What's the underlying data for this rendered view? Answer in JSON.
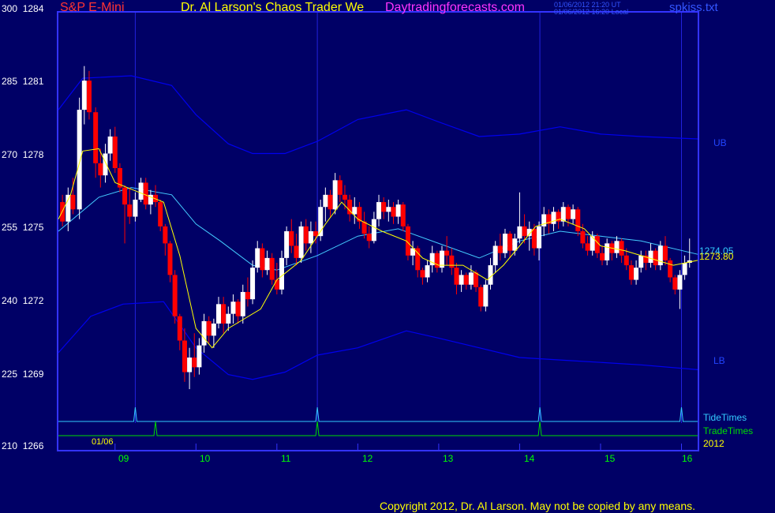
{
  "header": {
    "instrument": "S&P E-Mini",
    "title": "Dr. Al Larson's Chaos Trader We",
    "site": "Daytradingforecasts.com",
    "time_ut": "01/06/2012 21:20 UT",
    "time_local": "01/06/2012 16:20 Local",
    "file": "spkiss.txt"
  },
  "footer": {
    "copyright": "Copyright 2012, Dr. Al Larson. May not be copied by any means."
  },
  "colors": {
    "background": "#000066",
    "frame": "#3333ff",
    "up_candle": "#ffffff",
    "down_candle": "#ff0000",
    "band": "#0000ee",
    "mid_band": "#44ccff",
    "fast_ma": "#ffff00",
    "tide": "#33ccff",
    "trade": "#00dd00",
    "title": "#ffff00",
    "instrument": "#ff3333",
    "site": "#ff33ff"
  },
  "chart_data": {
    "type": "candlestick",
    "y_axis": {
      "ticks": [
        {
          "pos": 300,
          "price": 1284
        },
        {
          "pos": 285,
          "price": 1281
        },
        {
          "pos": 270,
          "price": 1278
        },
        {
          "pos": 255,
          "price": 1275
        },
        {
          "pos": 240,
          "price": 1272
        },
        {
          "pos": 225,
          "price": 1269
        },
        {
          "pos": 210,
          "price": 1266
        }
      ],
      "price_range": [
        1266,
        1284
      ]
    },
    "x_axis": {
      "ticks": [
        "09",
        "10",
        "11",
        "12",
        "13",
        "14",
        "15",
        "16"
      ],
      "start_label": "01/06",
      "year": "2012",
      "hour_range": [
        8.3,
        16.2
      ]
    },
    "band_labels": {
      "upper": "UB",
      "lower": "LB"
    },
    "last_values": {
      "mid_band": "1274.05",
      "close": "1273.80"
    },
    "lines_legend": {
      "tide": "TideTimes",
      "trade": "TradeTimes"
    },
    "tide_times": [
      9.25,
      11.5,
      14.25,
      16.0
    ],
    "trade_times": [
      9.5,
      11.5,
      14.25
    ],
    "band_mid": [
      [
        8.3,
        1275.0
      ],
      [
        8.8,
        1276.4
      ],
      [
        9.2,
        1276.8
      ],
      [
        9.7,
        1276.5
      ],
      [
        10.0,
        1275.3
      ],
      [
        10.3,
        1274.6
      ],
      [
        10.7,
        1273.6
      ],
      [
        11.0,
        1273.4
      ],
      [
        11.5,
        1274.0
      ],
      [
        12.0,
        1274.8
      ],
      [
        12.5,
        1275.1
      ],
      [
        13.0,
        1274.5
      ],
      [
        13.5,
        1273.9
      ],
      [
        14.0,
        1274.6
      ],
      [
        14.5,
        1275.0
      ],
      [
        15.0,
        1274.8
      ],
      [
        15.5,
        1274.6
      ],
      [
        16.2,
        1274.05
      ]
    ],
    "band_upper": [
      [
        8.3,
        1280.0
      ],
      [
        8.6,
        1281.3
      ],
      [
        9.2,
        1281.4
      ],
      [
        9.7,
        1281.0
      ],
      [
        10.0,
        1279.8
      ],
      [
        10.4,
        1278.6
      ],
      [
        10.7,
        1278.2
      ],
      [
        11.1,
        1278.2
      ],
      [
        11.5,
        1278.7
      ],
      [
        12.0,
        1279.6
      ],
      [
        12.6,
        1280.0
      ],
      [
        13.0,
        1279.5
      ],
      [
        13.5,
        1278.9
      ],
      [
        14.0,
        1279.0
      ],
      [
        14.5,
        1279.3
      ],
      [
        15.0,
        1279.0
      ],
      [
        15.5,
        1278.9
      ],
      [
        16.2,
        1278.8
      ]
    ],
    "band_lower": [
      [
        8.3,
        1270.0
      ],
      [
        8.7,
        1271.5
      ],
      [
        9.1,
        1272.0
      ],
      [
        9.6,
        1272.1
      ],
      [
        10.0,
        1270.2
      ],
      [
        10.4,
        1269.1
      ],
      [
        10.7,
        1268.9
      ],
      [
        11.1,
        1269.2
      ],
      [
        11.5,
        1269.9
      ],
      [
        12.0,
        1270.2
      ],
      [
        12.6,
        1270.9
      ],
      [
        13.0,
        1270.6
      ],
      [
        13.5,
        1270.2
      ],
      [
        14.0,
        1269.8
      ],
      [
        14.5,
        1269.7
      ],
      [
        15.0,
        1269.6
      ],
      [
        15.5,
        1269.5
      ],
      [
        16.2,
        1269.3
      ]
    ],
    "fast_ma": [
      [
        8.3,
        1275.5
      ],
      [
        8.45,
        1276.5
      ],
      [
        8.6,
        1278.3
      ],
      [
        8.8,
        1278.4
      ],
      [
        9.0,
        1277.0
      ],
      [
        9.3,
        1276.6
      ],
      [
        9.6,
        1276.2
      ],
      [
        9.8,
        1274.0
      ],
      [
        10.0,
        1271.0
      ],
      [
        10.2,
        1270.2
      ],
      [
        10.4,
        1271.0
      ],
      [
        10.8,
        1271.8
      ],
      [
        11.0,
        1273.0
      ],
      [
        11.3,
        1273.8
      ],
      [
        11.6,
        1275.3
      ],
      [
        11.8,
        1276.2
      ],
      [
        12.0,
        1275.5
      ],
      [
        12.3,
        1275.0
      ],
      [
        12.6,
        1274.6
      ],
      [
        12.8,
        1273.9
      ],
      [
        13.0,
        1273.6
      ],
      [
        13.3,
        1273.6
      ],
      [
        13.6,
        1273.0
      ],
      [
        13.8,
        1273.6
      ],
      [
        14.0,
        1274.4
      ],
      [
        14.2,
        1275.2
      ],
      [
        14.5,
        1275.5
      ],
      [
        14.8,
        1275.1
      ],
      [
        15.0,
        1274.4
      ],
      [
        15.3,
        1274.2
      ],
      [
        15.6,
        1273.9
      ],
      [
        15.9,
        1273.6
      ],
      [
        16.2,
        1273.8
      ]
    ],
    "candles": [
      [
        8.35,
        1276.2,
        1276.5,
        1275.2,
        1275.4
      ],
      [
        8.42,
        1275.4,
        1276.8,
        1275.0,
        1276.5
      ],
      [
        8.48,
        1276.5,
        1277.2,
        1275.7,
        1275.9
      ],
      [
        8.56,
        1275.9,
        1280.5,
        1275.5,
        1280.0
      ],
      [
        8.62,
        1280.0,
        1281.8,
        1279.4,
        1281.2
      ],
      [
        8.68,
        1281.2,
        1281.6,
        1279.6,
        1279.9
      ],
      [
        8.76,
        1279.9,
        1280.1,
        1277.2,
        1277.8
      ],
      [
        8.82,
        1277.8,
        1278.4,
        1276.8,
        1277.3
      ],
      [
        8.88,
        1277.3,
        1278.6,
        1277.0,
        1278.2
      ],
      [
        8.94,
        1278.2,
        1279.2,
        1277.9,
        1278.9
      ],
      [
        9.0,
        1278.9,
        1279.3,
        1277.4,
        1277.6
      ],
      [
        9.06,
        1277.6,
        1277.8,
        1276.6,
        1276.8
      ],
      [
        9.12,
        1276.8,
        1276.9,
        1274.5,
        1276.1
      ],
      [
        9.18,
        1276.1,
        1276.8,
        1275.3,
        1275.6
      ],
      [
        9.25,
        1275.6,
        1276.6,
        1275.4,
        1276.3
      ],
      [
        9.32,
        1276.3,
        1277.2,
        1276.2,
        1277.0
      ],
      [
        9.38,
        1277.0,
        1277.2,
        1275.9,
        1276.1
      ],
      [
        9.44,
        1276.1,
        1276.7,
        1275.7,
        1276.5
      ],
      [
        9.5,
        1276.5,
        1276.9,
        1276.0,
        1276.2
      ],
      [
        9.56,
        1276.2,
        1276.3,
        1275.0,
        1275.2
      ],
      [
        9.62,
        1275.2,
        1275.3,
        1274.0,
        1274.5
      ],
      [
        9.68,
        1274.5,
        1274.6,
        1272.9,
        1273.2
      ],
      [
        9.74,
        1273.2,
        1273.4,
        1271.2,
        1271.5
      ],
      [
        9.8,
        1271.5,
        1271.6,
        1270.1,
        1270.5
      ],
      [
        9.86,
        1270.5,
        1271.0,
        1268.8,
        1269.2
      ],
      [
        9.92,
        1269.2,
        1270.2,
        1268.5,
        1269.8
      ],
      [
        9.98,
        1269.8,
        1270.8,
        1269.0,
        1269.4
      ],
      [
        10.04,
        1269.4,
        1270.6,
        1269.1,
        1270.3
      ],
      [
        10.1,
        1270.3,
        1271.6,
        1270.0,
        1271.3
      ],
      [
        10.16,
        1271.3,
        1271.5,
        1270.4,
        1270.7
      ],
      [
        10.22,
        1270.7,
        1271.4,
        1270.2,
        1271.2
      ],
      [
        10.28,
        1271.2,
        1272.3,
        1271.0,
        1272.0
      ],
      [
        10.34,
        1272.0,
        1272.3,
        1270.8,
        1271.2
      ],
      [
        10.4,
        1271.2,
        1271.9,
        1270.9,
        1271.6
      ],
      [
        10.46,
        1271.6,
        1272.4,
        1271.2,
        1272.1
      ],
      [
        10.52,
        1272.1,
        1272.2,
        1271.2,
        1271.5
      ],
      [
        10.58,
        1271.5,
        1272.8,
        1271.2,
        1272.5
      ],
      [
        10.64,
        1272.5,
        1273.1,
        1271.9,
        1272.2
      ],
      [
        10.7,
        1272.2,
        1273.8,
        1272.0,
        1273.5
      ],
      [
        10.76,
        1273.5,
        1274.6,
        1273.3,
        1274.3
      ],
      [
        10.82,
        1274.3,
        1274.5,
        1273.1,
        1273.4
      ],
      [
        10.88,
        1273.4,
        1274.2,
        1273.2,
        1273.9
      ],
      [
        10.94,
        1273.9,
        1274.1,
        1272.8,
        1273.0
      ],
      [
        11.0,
        1273.0,
        1273.7,
        1272.4,
        1272.6
      ],
      [
        11.06,
        1272.6,
        1274.2,
        1272.4,
        1273.9
      ],
      [
        11.12,
        1273.9,
        1275.2,
        1273.6,
        1275.0
      ],
      [
        11.18,
        1275.0,
        1275.5,
        1274.1,
        1274.4
      ],
      [
        11.24,
        1274.4,
        1274.9,
        1273.6,
        1273.9
      ],
      [
        11.3,
        1273.9,
        1275.4,
        1273.7,
        1275.2
      ],
      [
        11.36,
        1275.2,
        1275.5,
        1274.2,
        1274.5
      ],
      [
        11.42,
        1274.5,
        1275.4,
        1274.1,
        1275.0
      ],
      [
        11.48,
        1275.0,
        1275.4,
        1274.5,
        1274.8
      ],
      [
        11.54,
        1274.8,
        1276.3,
        1274.6,
        1276.0
      ],
      [
        11.6,
        1276.0,
        1276.8,
        1275.4,
        1276.5
      ],
      [
        11.66,
        1276.5,
        1276.7,
        1275.6,
        1275.9
      ],
      [
        11.72,
        1275.9,
        1277.4,
        1275.7,
        1277.1
      ],
      [
        11.78,
        1277.1,
        1277.3,
        1276.2,
        1276.5
      ],
      [
        11.84,
        1276.5,
        1276.9,
        1275.9,
        1276.3
      ],
      [
        11.9,
        1276.3,
        1276.5,
        1275.4,
        1275.7
      ],
      [
        11.96,
        1275.7,
        1276.4,
        1275.3,
        1276.0
      ],
      [
        12.02,
        1276.0,
        1276.2,
        1275.1,
        1275.4
      ],
      [
        12.08,
        1275.4,
        1275.8,
        1274.7,
        1274.9
      ],
      [
        12.14,
        1274.9,
        1275.2,
        1274.3,
        1274.6
      ],
      [
        12.2,
        1274.6,
        1275.8,
        1274.5,
        1275.5
      ],
      [
        12.26,
        1275.5,
        1276.5,
        1275.2,
        1276.2
      ],
      [
        12.32,
        1276.2,
        1276.4,
        1275.5,
        1275.8
      ],
      [
        12.38,
        1275.8,
        1276.3,
        1275.4,
        1276.0
      ],
      [
        12.44,
        1276.0,
        1276.2,
        1275.3,
        1275.6
      ],
      [
        12.5,
        1275.6,
        1276.3,
        1275.3,
        1276.1
      ],
      [
        12.56,
        1276.1,
        1276.2,
        1275.0,
        1275.2
      ],
      [
        12.62,
        1275.2,
        1275.3,
        1273.8,
        1274.0
      ],
      [
        12.68,
        1274.0,
        1274.6,
        1273.6,
        1274.3
      ],
      [
        12.74,
        1274.3,
        1274.4,
        1273.1,
        1273.4
      ],
      [
        12.8,
        1273.4,
        1273.5,
        1272.8,
        1273.1
      ],
      [
        12.86,
        1273.1,
        1273.8,
        1272.9,
        1273.6
      ],
      [
        12.92,
        1273.6,
        1274.4,
        1273.3,
        1274.1
      ],
      [
        12.98,
        1274.1,
        1274.2,
        1273.3,
        1273.5
      ],
      [
        13.04,
        1273.5,
        1274.4,
        1273.3,
        1274.2
      ],
      [
        13.1,
        1274.2,
        1274.8,
        1273.6,
        1274.0
      ],
      [
        13.16,
        1274.0,
        1274.3,
        1273.2,
        1273.5
      ],
      [
        13.22,
        1273.5,
        1273.7,
        1272.4,
        1272.8
      ],
      [
        13.28,
        1272.8,
        1273.4,
        1272.5,
        1273.2
      ],
      [
        13.34,
        1273.2,
        1273.3,
        1272.6,
        1272.8
      ],
      [
        13.4,
        1272.8,
        1273.6,
        1272.6,
        1273.3
      ],
      [
        13.46,
        1273.3,
        1273.4,
        1272.5,
        1272.7
      ],
      [
        13.52,
        1272.7,
        1272.8,
        1271.7,
        1271.9
      ],
      [
        13.58,
        1271.9,
        1273.0,
        1271.7,
        1272.8
      ],
      [
        13.64,
        1272.8,
        1273.9,
        1272.6,
        1273.6
      ],
      [
        13.7,
        1273.6,
        1274.6,
        1273.3,
        1274.4
      ],
      [
        13.76,
        1274.4,
        1274.9,
        1273.8,
        1274.1
      ],
      [
        13.82,
        1274.1,
        1275.1,
        1273.9,
        1274.9
      ],
      [
        13.88,
        1274.9,
        1275.0,
        1273.9,
        1274.2
      ],
      [
        13.94,
        1274.2,
        1274.9,
        1274.0,
        1274.7
      ],
      [
        14.0,
        1274.7,
        1276.6,
        1274.5,
        1275.2
      ],
      [
        14.06,
        1275.2,
        1275.7,
        1274.5,
        1274.8
      ],
      [
        14.12,
        1274.8,
        1275.4,
        1274.2,
        1275.1
      ],
      [
        14.18,
        1275.1,
        1275.3,
        1274.0,
        1274.3
      ],
      [
        14.24,
        1274.3,
        1275.4,
        1273.8,
        1275.2
      ],
      [
        14.3,
        1275.2,
        1276.0,
        1274.8,
        1275.7
      ],
      [
        14.36,
        1275.7,
        1275.9,
        1274.9,
        1275.3
      ],
      [
        14.42,
        1275.3,
        1276.0,
        1275.0,
        1275.8
      ],
      [
        14.48,
        1275.8,
        1275.9,
        1275.1,
        1275.4
      ],
      [
        14.54,
        1275.4,
        1276.2,
        1275.2,
        1276.0
      ],
      [
        14.6,
        1276.0,
        1276.1,
        1275.2,
        1275.5
      ],
      [
        14.66,
        1275.5,
        1276.1,
        1275.3,
        1275.9
      ],
      [
        14.72,
        1275.9,
        1276.0,
        1274.8,
        1275.0
      ],
      [
        14.78,
        1275.0,
        1275.3,
        1274.3,
        1274.5
      ],
      [
        14.84,
        1274.5,
        1274.8,
        1274.0,
        1274.2
      ],
      [
        14.9,
        1274.2,
        1275.0,
        1274.0,
        1274.8
      ],
      [
        14.96,
        1274.8,
        1274.9,
        1273.9,
        1274.1
      ],
      [
        15.02,
        1274.1,
        1274.4,
        1273.6,
        1273.8
      ],
      [
        15.08,
        1273.8,
        1274.7,
        1273.6,
        1274.5
      ],
      [
        15.14,
        1274.5,
        1274.6,
        1273.8,
        1274.1
      ],
      [
        15.2,
        1274.1,
        1274.8,
        1273.9,
        1274.6
      ],
      [
        15.26,
        1274.6,
        1274.7,
        1273.7,
        1274.0
      ],
      [
        15.32,
        1274.0,
        1274.3,
        1273.4,
        1273.6
      ],
      [
        15.38,
        1273.6,
        1273.8,
        1272.8,
        1273.0
      ],
      [
        15.44,
        1273.0,
        1273.8,
        1272.8,
        1273.5
      ],
      [
        15.5,
        1273.5,
        1274.2,
        1273.3,
        1274.0
      ],
      [
        15.56,
        1274.0,
        1274.2,
        1273.4,
        1273.7
      ],
      [
        15.62,
        1273.7,
        1274.5,
        1273.5,
        1274.2
      ],
      [
        15.68,
        1274.2,
        1274.3,
        1273.4,
        1273.6
      ],
      [
        15.74,
        1273.6,
        1274.6,
        1273.4,
        1274.4
      ],
      [
        15.8,
        1274.4,
        1274.8,
        1273.6,
        1273.8
      ],
      [
        15.86,
        1273.8,
        1273.9,
        1272.9,
        1273.1
      ],
      [
        15.92,
        1273.1,
        1273.2,
        1272.4,
        1272.6
      ],
      [
        15.98,
        1272.6,
        1273.4,
        1271.8,
        1273.2
      ],
      [
        16.04,
        1273.2,
        1274.0,
        1273.0,
        1273.7
      ],
      [
        16.1,
        1273.7,
        1274.7,
        1273.5,
        1273.8
      ]
    ]
  }
}
